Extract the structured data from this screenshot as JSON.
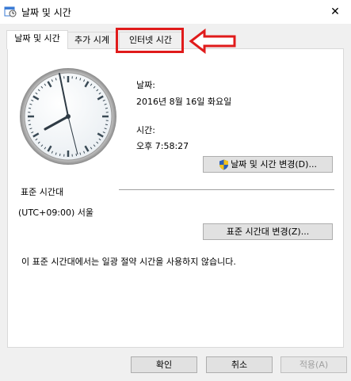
{
  "window": {
    "title": "날짜 및 시간",
    "close_glyph": "✕"
  },
  "tabs": [
    {
      "label": "날짜 및 시간",
      "active": true
    },
    {
      "label": "추가 시계",
      "active": false
    },
    {
      "label": "인터넷 시간",
      "active": false
    }
  ],
  "date_section": {
    "date_label": "날짜:",
    "date_value": "2016년 8월 16일 화요일",
    "time_label": "시간:",
    "time_value": "오후 7:58:27",
    "change_button": "날짜 및 시간 변경(D)..."
  },
  "timezone_section": {
    "heading": "표준 시간대",
    "value": "(UTC+09:00) 서울",
    "change_button": "표준 시간대 변경(Z)...",
    "dst_note": "이 표준 시간대에서는 일광 절약 시간을 사용하지 않습니다."
  },
  "footer": {
    "ok": "확인",
    "cancel": "취소",
    "apply": "적용(A)"
  },
  "annotation": {
    "color": "#e01b1b"
  },
  "icons": {
    "window_icon": "calendar-clock-icon",
    "uac": "uac-shield-icon",
    "annotation": "arrow-left-icon"
  }
}
